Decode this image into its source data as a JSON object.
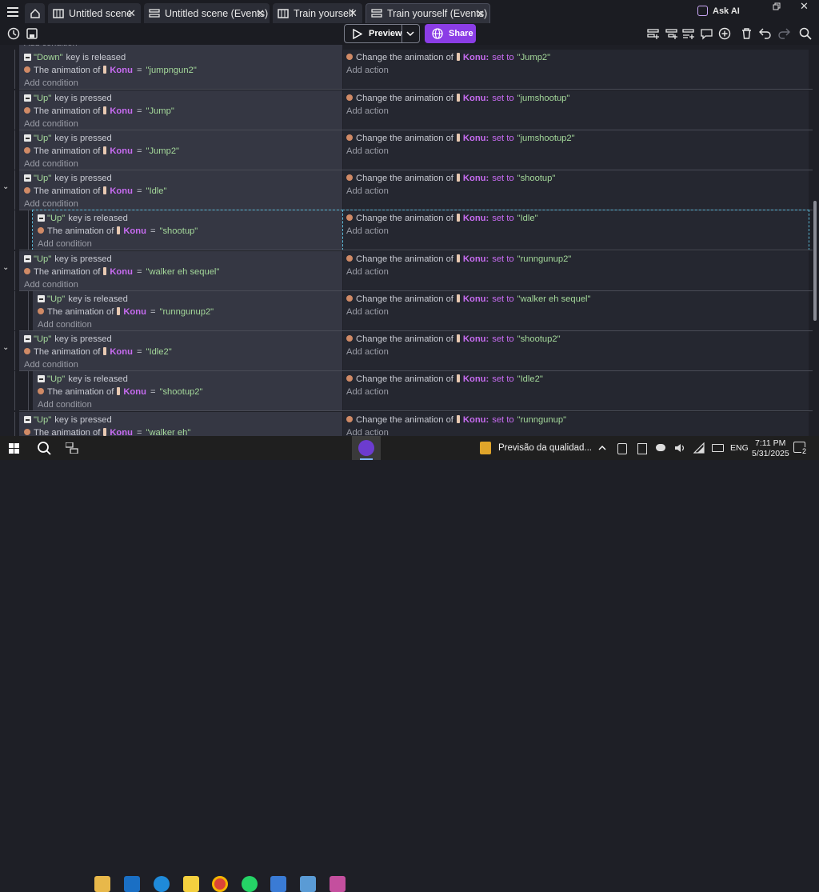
{
  "tabs": [
    {
      "label": "Untitled scene"
    },
    {
      "label": "Untitled scene (Events)"
    },
    {
      "label": "Train yourself"
    },
    {
      "label": "Train yourself (Events)"
    }
  ],
  "header": {
    "ask_ai": "Ask AI",
    "preview": "Preview",
    "share": "Share"
  },
  "common": {
    "add_condition": "Add condition",
    "add_action": "Add action",
    "key_pressed": "key is pressed",
    "key_released": "key is released",
    "anim_of": "The animation of",
    "change_anim": "Change the animation of",
    "object": "Konu",
    "object_colon": "Konu:",
    "set_to": "set to",
    "equals": "="
  },
  "events": [
    {
      "key": "\"Down\"",
      "verb": "released",
      "cond_anim": "\"jumpngun2\"",
      "act_anim": "\"Jump2\""
    },
    {
      "key": "\"Up\"",
      "verb": "pressed",
      "cond_anim": "\"Jump\"",
      "act_anim": "\"jumshootup\""
    },
    {
      "key": "\"Up\"",
      "verb": "pressed",
      "cond_anim": "\"Jump2\"",
      "act_anim": "\"jumshootup2\""
    },
    {
      "key": "\"Up\"",
      "verb": "pressed",
      "cond_anim": "\"Idle\"",
      "act_anim": "\"shootup\""
    },
    {
      "key": "\"Up\"",
      "verb": "released",
      "cond_anim": "\"shootup\"",
      "act_anim": "\"Idle\""
    },
    {
      "key": "\"Up\"",
      "verb": "pressed",
      "cond_anim": "\"walker eh sequel\"",
      "act_anim": "\"runngunup2\""
    },
    {
      "key": "\"Up\"",
      "verb": "released",
      "cond_anim": "\"runngunup2\"",
      "act_anim": "\"walker eh sequel\""
    },
    {
      "key": "\"Up\"",
      "verb": "pressed",
      "cond_anim": "\"Idle2\"",
      "act_anim": "\"shootup2\""
    },
    {
      "key": "\"Up\"",
      "verb": "released",
      "cond_anim": "\"shootup2\"",
      "act_anim": "\"Idle2\""
    },
    {
      "key": "\"Up\"",
      "verb": "pressed",
      "cond_anim": "\"walker eh\"",
      "act_anim": "\"runngunup\""
    }
  ],
  "taskbar": {
    "weather": "Previsão da qualidad...",
    "lang": "ENG",
    "time": "7:11 PM",
    "date": "5/31/2025",
    "notif_count": "2"
  },
  "colors": {
    "accent": "#8b3de6",
    "object": "#c86cf2",
    "string": "#a4d89a"
  }
}
